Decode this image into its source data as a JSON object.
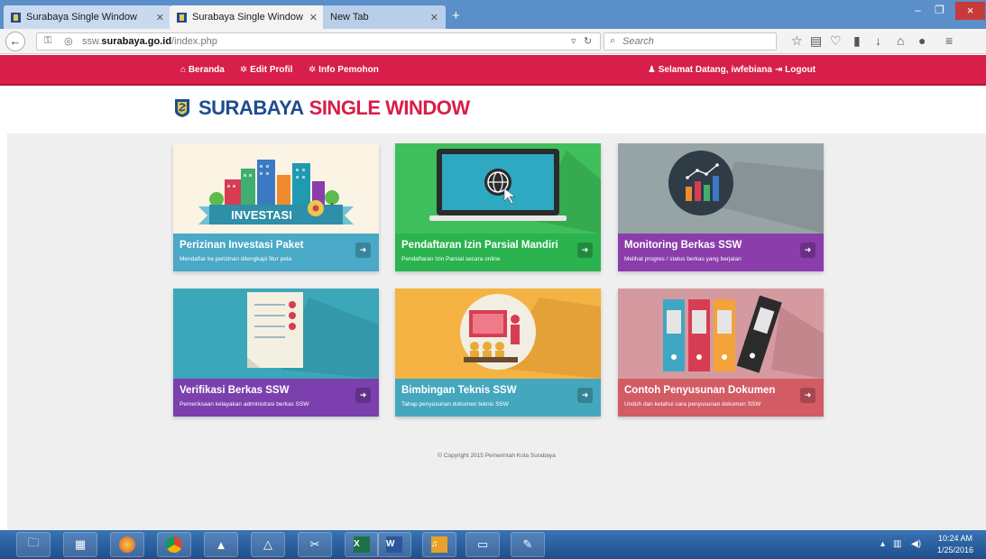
{
  "browser": {
    "tabs": [
      {
        "title": "Surabaya Single Window",
        "state": "inactive"
      },
      {
        "title": "Surabaya Single Window",
        "state": "active"
      },
      {
        "title": "New Tab",
        "state": "inactive"
      }
    ],
    "new_tab_symbol": "+",
    "window_controls": {
      "minimize": "–",
      "restore": "❐",
      "close": "×"
    },
    "url_prefix": "ssw.",
    "url_domain": "surabaya.go.id",
    "url_path": "/index.php",
    "search_placeholder": "Search"
  },
  "site_menu": {
    "left": [
      {
        "icon": "home-icon",
        "label": "Beranda"
      },
      {
        "icon": "gear-icon",
        "label": "Edit Profil"
      },
      {
        "icon": "gear-icon",
        "label": "Info Pemohon"
      }
    ],
    "right": [
      {
        "icon": "user-icon",
        "label": "Selamat Datang, iwfebiana"
      },
      {
        "icon": "logout-icon",
        "label": "Logout"
      }
    ]
  },
  "header": {
    "logo_part1": "SURABAYA",
    "logo_part2": "SINGLE WINDOW"
  },
  "cards": [
    {
      "title": "Perizinan Investasi Paket",
      "subtitle": "Mendaftar ke perizinan dilengkapi fitur peta",
      "banner": "INVESTASI",
      "color": "#4aa9c6"
    },
    {
      "title": "Pendaftaran Izin Parsial Mandiri",
      "subtitle": "Pendaftaran Izin Parsial secara online",
      "color": "#2ab34f"
    },
    {
      "title": "Monitoring Berkas SSW",
      "subtitle": "Melihat progres / status berkas yang berjalan",
      "color": "#8a3dab"
    },
    {
      "title": "Verifikasi Berkas SSW",
      "subtitle": "Pemeriksaan kelayakan administrasi berkas SSW",
      "color": "#7b3fae"
    },
    {
      "title": "Bimbingan Teknis SSW",
      "subtitle": "Tahap penyusunan dokumen teknis SSW",
      "color": "#45a7bd"
    },
    {
      "title": "Contoh Penyusunan Dokumen",
      "subtitle": "Unduh dan ketahui cara penyusunan dokumen SSW",
      "color": "#d25b64"
    }
  ],
  "footer": {
    "copyright": "© Copyright 2015 Pemerintah Kota Surabaya"
  },
  "taskbar": {
    "apps": [
      "start-button",
      "file-explorer-icon",
      "control-panel-icon",
      "firefox-icon",
      "chrome-icon",
      "paint-icon",
      "autocad-icon",
      "snipping-tool-icon",
      "excel-icon",
      "word-icon",
      "fl-studio-icon",
      "network-icon",
      "paint-brush-icon"
    ],
    "clock_time": "10:24 AM",
    "clock_date": "1/25/2016"
  }
}
